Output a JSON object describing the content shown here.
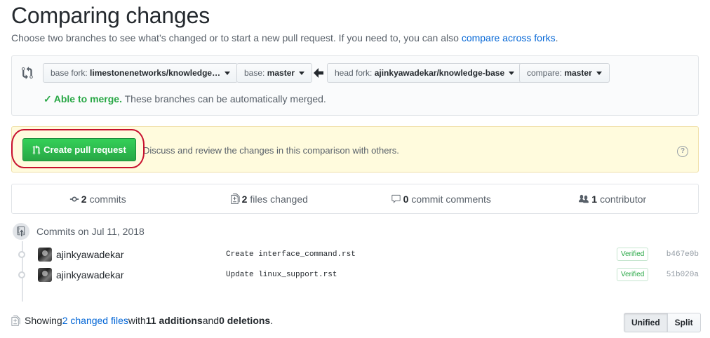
{
  "page": {
    "title": "Comparing changes",
    "subtitle_prefix": "Choose two branches to see what’s changed or to start a new pull request. If you need to, you can also ",
    "subtitle_link": "compare across forks",
    "subtitle_suffix": "."
  },
  "range": {
    "base_fork_label": "base fork:",
    "base_fork_value": "limestonenetworks/knowledge…",
    "base_label": "base:",
    "base_value": "master",
    "head_fork_label": "head fork:",
    "head_fork_value": "ajinkyawadekar/knowledge-base",
    "compare_label": "compare:",
    "compare_value": "master",
    "merge_check": "✓",
    "merge_ok": "Able to merge.",
    "merge_text": " These branches can be automatically merged."
  },
  "pull_request": {
    "button_label": "Create pull request",
    "description": "Discuss and review the changes in this comparison with others.",
    "help": "?"
  },
  "summary": {
    "commits_count": "2",
    "commits_label": "commits",
    "files_count": "2",
    "files_label": "files changed",
    "comments_count": "0",
    "comments_label": "commit comments",
    "contributors_count": "1",
    "contributors_label": "contributor"
  },
  "commits": {
    "date_label": "Commits on Jul 11, 2018",
    "items": [
      {
        "author": "ajinkyawadekar",
        "message": "Create interface_command.rst",
        "verified": "Verified",
        "sha": "b467e0b"
      },
      {
        "author": "ajinkyawadekar",
        "message": "Update linux_support.rst",
        "verified": "Verified",
        "sha": "51b020a"
      }
    ]
  },
  "footer": {
    "showing": "Showing ",
    "changed_files_link": "2 changed files",
    "with": " with ",
    "additions": "11 additions",
    "and": " and ",
    "deletions": "0 deletions",
    "period": ".",
    "unified_label": "Unified",
    "split_label": "Split"
  },
  "colors": {
    "accent_link": "#0366d6",
    "success_green": "#28a745",
    "annotation_red": "#c8102e",
    "notice_background": "#fffbdd"
  }
}
